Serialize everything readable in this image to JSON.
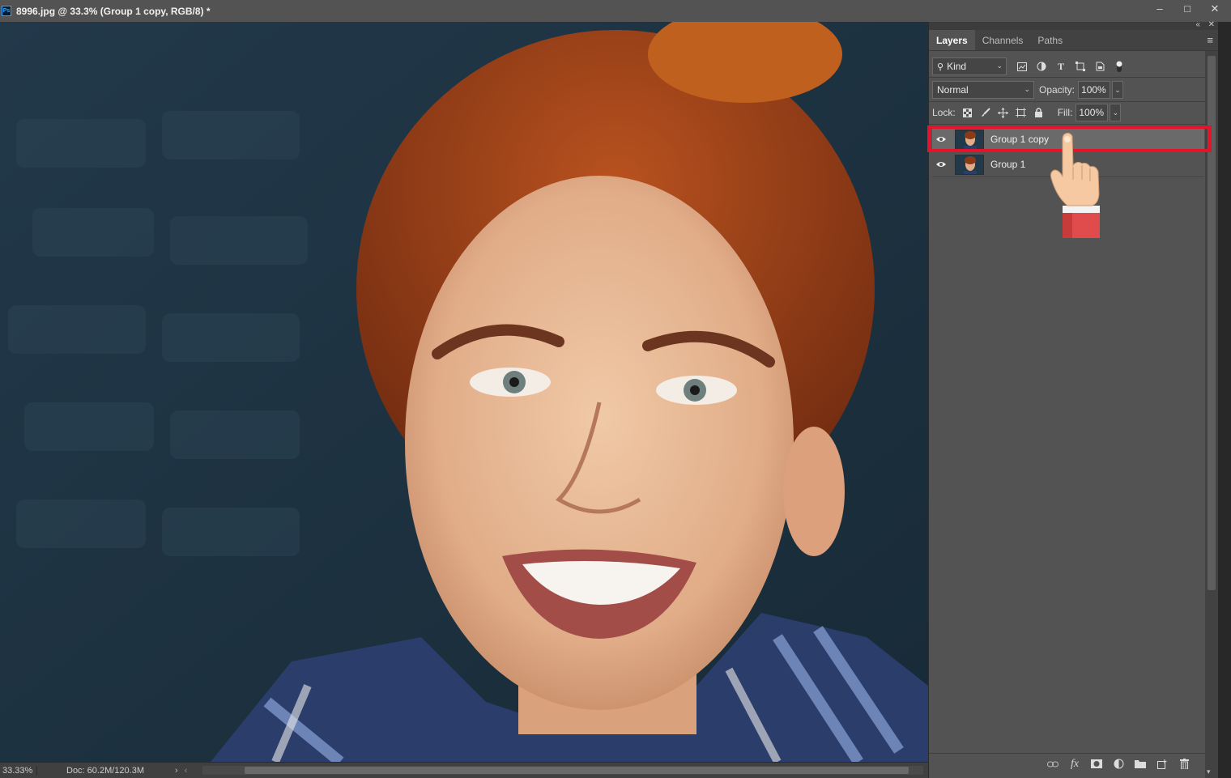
{
  "window": {
    "app_badge": "Ps",
    "document_title": "8996.jpg @ 33.3% (Group 1 copy, RGB/8) *",
    "controls": {
      "minimize": "–",
      "maximize": "□",
      "close": "✕"
    }
  },
  "panel": {
    "collapse_icon": "«",
    "close_icon": "✕",
    "menu_icon": "≡",
    "tabs": [
      {
        "label": "Layers",
        "active": true
      },
      {
        "label": "Channels",
        "active": false
      },
      {
        "label": "Paths",
        "active": false
      }
    ],
    "filter": {
      "search_icon": "search-icon",
      "kind_label": "Kind",
      "filter_icons": [
        "image-filter-icon",
        "adjustment-filter-icon",
        "type-filter-icon",
        "shape-filter-icon",
        "smart-object-filter-icon",
        "filter-toggle-icon"
      ]
    },
    "blend_mode": "Normal",
    "opacity_label": "Opacity:",
    "opacity_value": "100%",
    "lock_label": "Lock:",
    "fill_label": "Fill:",
    "fill_value": "100%",
    "layers": [
      {
        "name": "Group 1 copy",
        "visible": true,
        "selected": true
      },
      {
        "name": "Group 1",
        "visible": true,
        "selected": false
      }
    ],
    "footer_icons": [
      "link-icon",
      "fx-icon",
      "mask-icon",
      "adjustment-layer-icon",
      "group-folder-icon",
      "new-layer-icon",
      "trash-icon"
    ],
    "footer_fx": "fx"
  },
  "status": {
    "zoom": "33.33%",
    "doc_info": "Doc: 60.2M/120.3M",
    "arrow": "›",
    "scroll_left": "‹"
  },
  "colors": {
    "highlight": "#e3132c",
    "panel_bg": "#535353",
    "selected_layer": "#6a6a6a"
  }
}
